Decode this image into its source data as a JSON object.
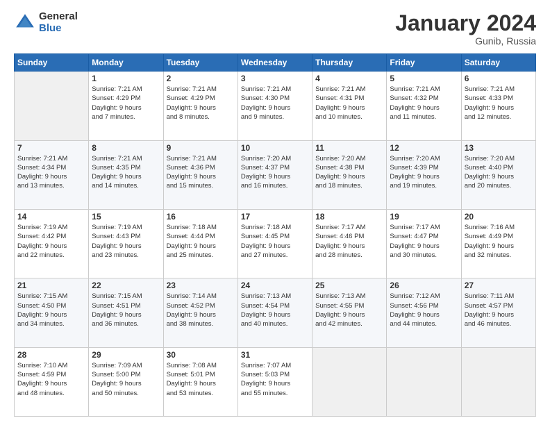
{
  "logo": {
    "general": "General",
    "blue": "Blue"
  },
  "header": {
    "title": "January 2024",
    "location": "Gunib, Russia"
  },
  "weekdays": [
    "Sunday",
    "Monday",
    "Tuesday",
    "Wednesday",
    "Thursday",
    "Friday",
    "Saturday"
  ],
  "weeks": [
    [
      {
        "num": "",
        "info": ""
      },
      {
        "num": "1",
        "info": "Sunrise: 7:21 AM\nSunset: 4:29 PM\nDaylight: 9 hours\nand 7 minutes."
      },
      {
        "num": "2",
        "info": "Sunrise: 7:21 AM\nSunset: 4:29 PM\nDaylight: 9 hours\nand 8 minutes."
      },
      {
        "num": "3",
        "info": "Sunrise: 7:21 AM\nSunset: 4:30 PM\nDaylight: 9 hours\nand 9 minutes."
      },
      {
        "num": "4",
        "info": "Sunrise: 7:21 AM\nSunset: 4:31 PM\nDaylight: 9 hours\nand 10 minutes."
      },
      {
        "num": "5",
        "info": "Sunrise: 7:21 AM\nSunset: 4:32 PM\nDaylight: 9 hours\nand 11 minutes."
      },
      {
        "num": "6",
        "info": "Sunrise: 7:21 AM\nSunset: 4:33 PM\nDaylight: 9 hours\nand 12 minutes."
      }
    ],
    [
      {
        "num": "7",
        "info": "Sunrise: 7:21 AM\nSunset: 4:34 PM\nDaylight: 9 hours\nand 13 minutes."
      },
      {
        "num": "8",
        "info": "Sunrise: 7:21 AM\nSunset: 4:35 PM\nDaylight: 9 hours\nand 14 minutes."
      },
      {
        "num": "9",
        "info": "Sunrise: 7:21 AM\nSunset: 4:36 PM\nDaylight: 9 hours\nand 15 minutes."
      },
      {
        "num": "10",
        "info": "Sunrise: 7:20 AM\nSunset: 4:37 PM\nDaylight: 9 hours\nand 16 minutes."
      },
      {
        "num": "11",
        "info": "Sunrise: 7:20 AM\nSunset: 4:38 PM\nDaylight: 9 hours\nand 18 minutes."
      },
      {
        "num": "12",
        "info": "Sunrise: 7:20 AM\nSunset: 4:39 PM\nDaylight: 9 hours\nand 19 minutes."
      },
      {
        "num": "13",
        "info": "Sunrise: 7:20 AM\nSunset: 4:40 PM\nDaylight: 9 hours\nand 20 minutes."
      }
    ],
    [
      {
        "num": "14",
        "info": "Sunrise: 7:19 AM\nSunset: 4:42 PM\nDaylight: 9 hours\nand 22 minutes."
      },
      {
        "num": "15",
        "info": "Sunrise: 7:19 AM\nSunset: 4:43 PM\nDaylight: 9 hours\nand 23 minutes."
      },
      {
        "num": "16",
        "info": "Sunrise: 7:18 AM\nSunset: 4:44 PM\nDaylight: 9 hours\nand 25 minutes."
      },
      {
        "num": "17",
        "info": "Sunrise: 7:18 AM\nSunset: 4:45 PM\nDaylight: 9 hours\nand 27 minutes."
      },
      {
        "num": "18",
        "info": "Sunrise: 7:17 AM\nSunset: 4:46 PM\nDaylight: 9 hours\nand 28 minutes."
      },
      {
        "num": "19",
        "info": "Sunrise: 7:17 AM\nSunset: 4:47 PM\nDaylight: 9 hours\nand 30 minutes."
      },
      {
        "num": "20",
        "info": "Sunrise: 7:16 AM\nSunset: 4:49 PM\nDaylight: 9 hours\nand 32 minutes."
      }
    ],
    [
      {
        "num": "21",
        "info": "Sunrise: 7:15 AM\nSunset: 4:50 PM\nDaylight: 9 hours\nand 34 minutes."
      },
      {
        "num": "22",
        "info": "Sunrise: 7:15 AM\nSunset: 4:51 PM\nDaylight: 9 hours\nand 36 minutes."
      },
      {
        "num": "23",
        "info": "Sunrise: 7:14 AM\nSunset: 4:52 PM\nDaylight: 9 hours\nand 38 minutes."
      },
      {
        "num": "24",
        "info": "Sunrise: 7:13 AM\nSunset: 4:54 PM\nDaylight: 9 hours\nand 40 minutes."
      },
      {
        "num": "25",
        "info": "Sunrise: 7:13 AM\nSunset: 4:55 PM\nDaylight: 9 hours\nand 42 minutes."
      },
      {
        "num": "26",
        "info": "Sunrise: 7:12 AM\nSunset: 4:56 PM\nDaylight: 9 hours\nand 44 minutes."
      },
      {
        "num": "27",
        "info": "Sunrise: 7:11 AM\nSunset: 4:57 PM\nDaylight: 9 hours\nand 46 minutes."
      }
    ],
    [
      {
        "num": "28",
        "info": "Sunrise: 7:10 AM\nSunset: 4:59 PM\nDaylight: 9 hours\nand 48 minutes."
      },
      {
        "num": "29",
        "info": "Sunrise: 7:09 AM\nSunset: 5:00 PM\nDaylight: 9 hours\nand 50 minutes."
      },
      {
        "num": "30",
        "info": "Sunrise: 7:08 AM\nSunset: 5:01 PM\nDaylight: 9 hours\nand 53 minutes."
      },
      {
        "num": "31",
        "info": "Sunrise: 7:07 AM\nSunset: 5:03 PM\nDaylight: 9 hours\nand 55 minutes."
      },
      {
        "num": "",
        "info": ""
      },
      {
        "num": "",
        "info": ""
      },
      {
        "num": "",
        "info": ""
      }
    ]
  ]
}
